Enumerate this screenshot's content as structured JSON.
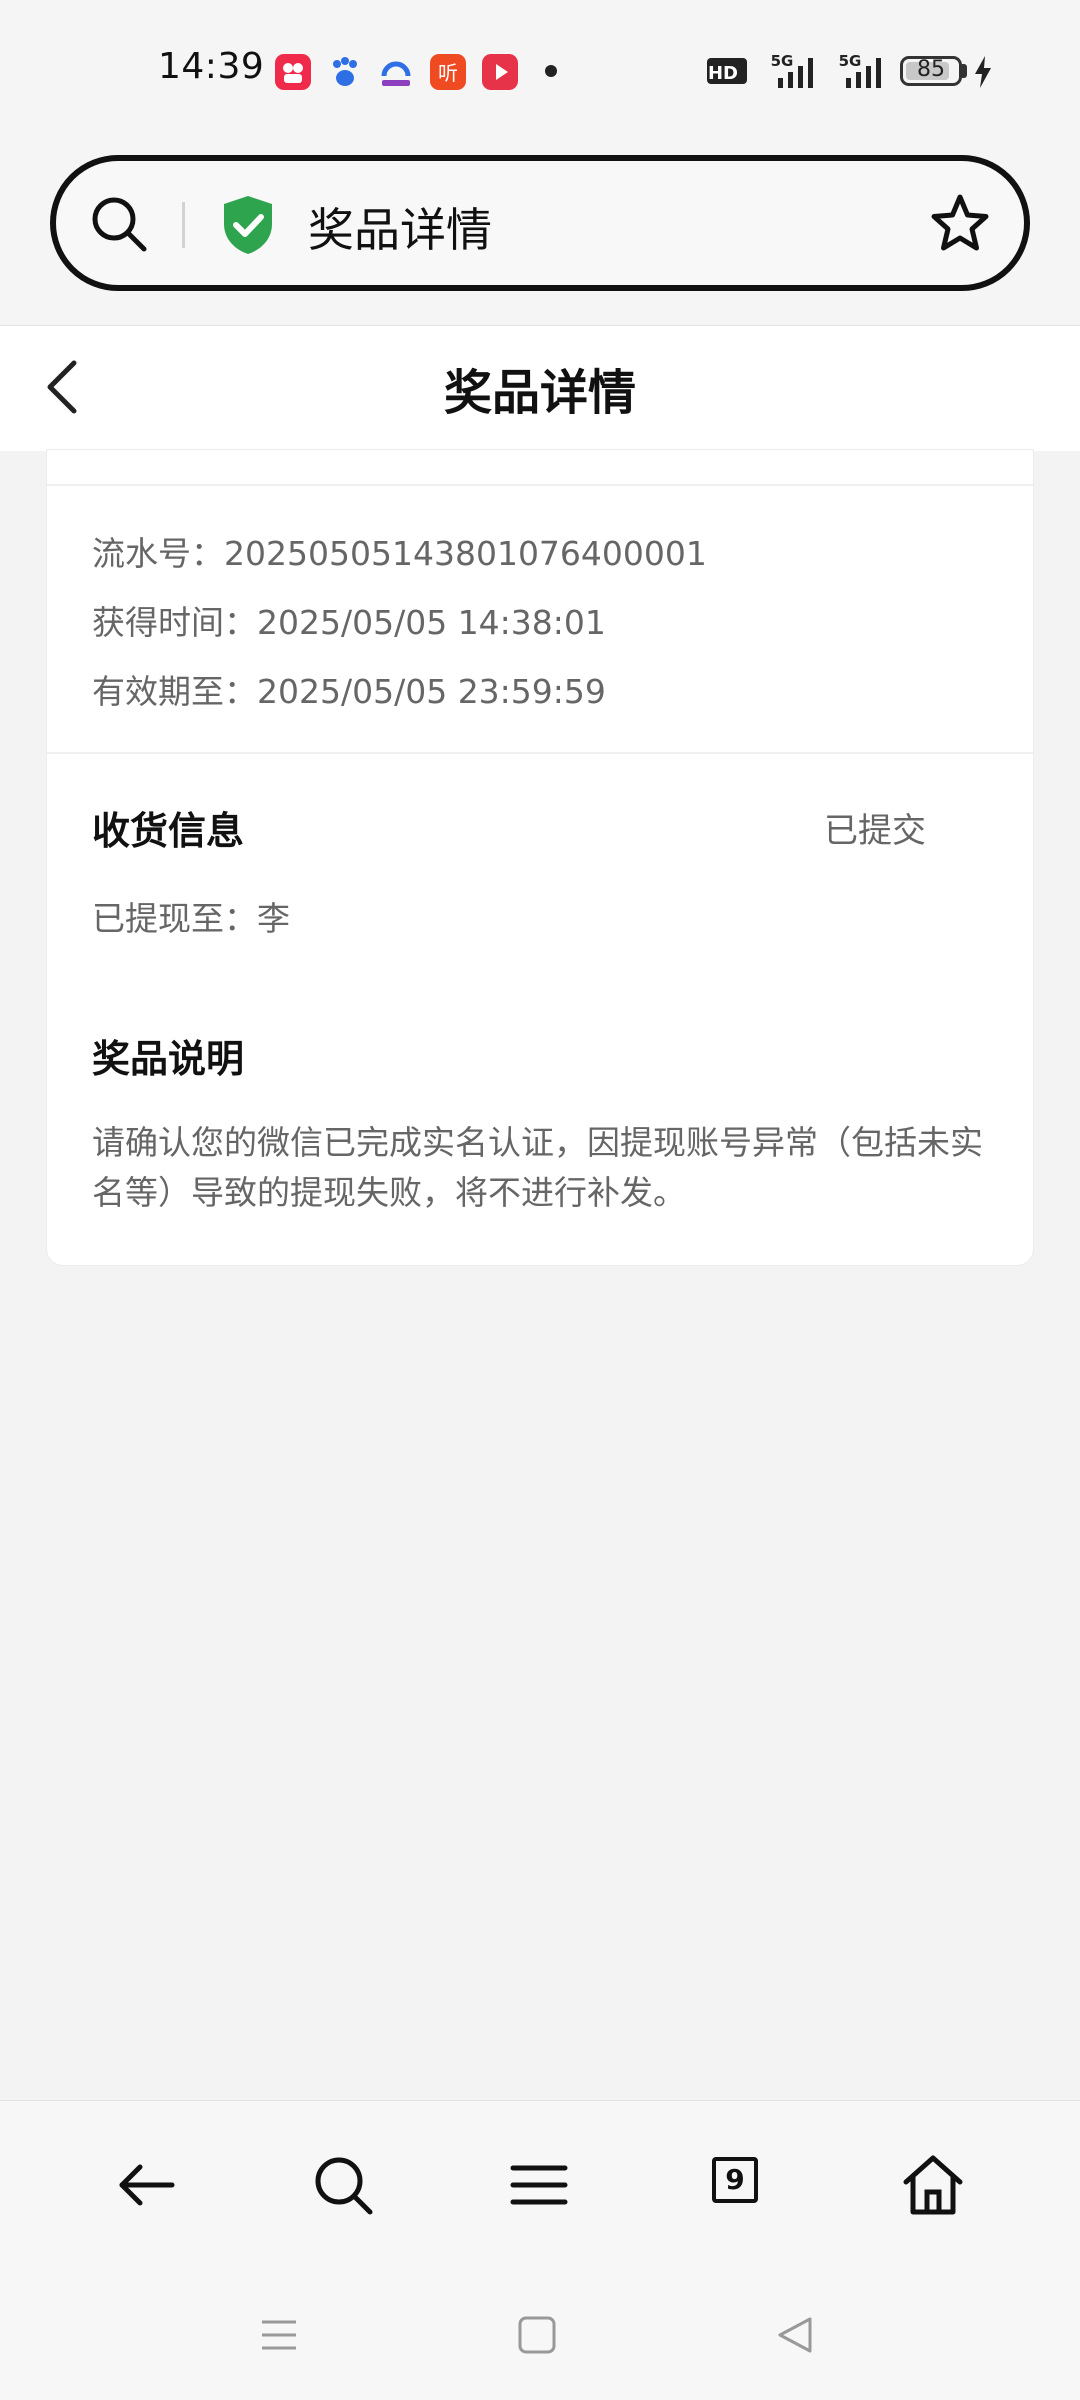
{
  "status_bar": {
    "time": "14:39",
    "battery_level": "85",
    "battery_fraction": 0.85,
    "network_labels": [
      "HD",
      "5G",
      "5G"
    ],
    "app_icons": [
      "kuaishou-app-icon",
      "baidu-app-icon",
      "map-app-icon",
      "listen-app-icon",
      "video-app-icon"
    ]
  },
  "browser": {
    "address_title": "奖品详情",
    "tab_count": "9"
  },
  "page": {
    "title": "奖品详情"
  },
  "order_info": {
    "serial": "流水号：2025050514380107640000‌1",
    "obtained_time": "获得时间：2025/05/05 14:38:01",
    "valid_until": "有效期至：2025/05/05 23:59:59"
  },
  "shipping": {
    "title": "收货信息",
    "status": "已提交",
    "withdraw_to": "已提现至：李"
  },
  "prize_desc": {
    "title": "奖品说明",
    "text": "请确认您的微信已完成实名认证，因提现账号异常（包括未实名等）导致的提现失败，将不进行补发。"
  },
  "colors": {
    "shield_green": "#2ea44f",
    "kuaishou_red": "#ef2a4a",
    "listen_orange": "#f04a23",
    "video_red": "#e6334a",
    "baidu_blue": "#2f6fe6"
  }
}
